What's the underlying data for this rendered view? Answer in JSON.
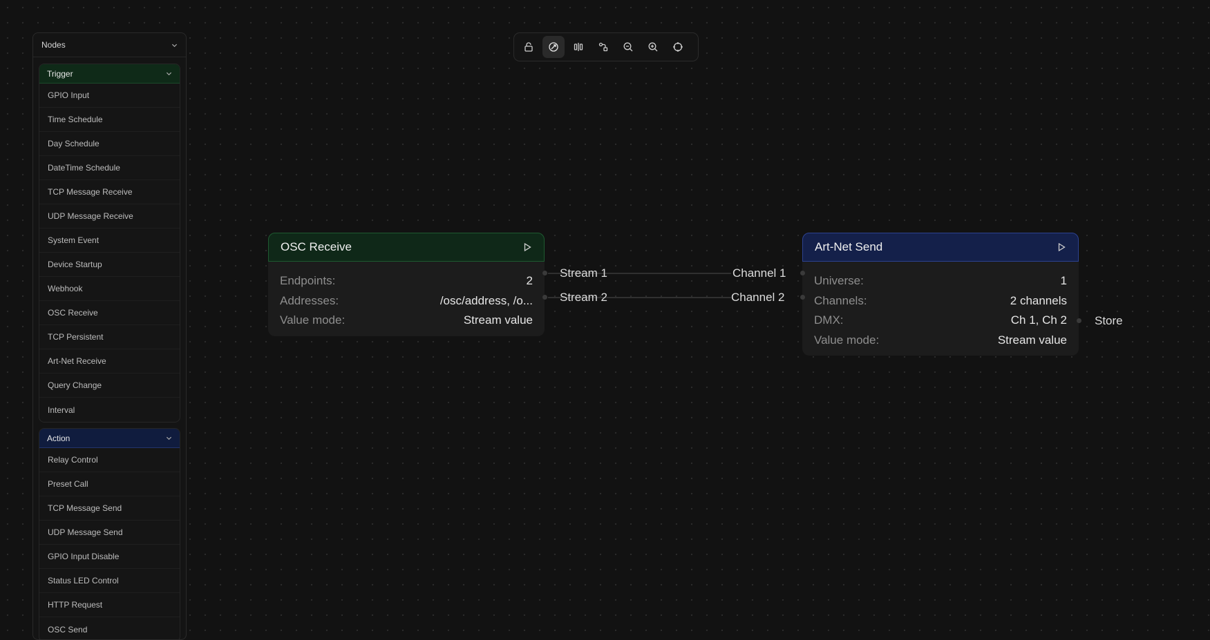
{
  "sidebar": {
    "title": "Nodes",
    "groups": [
      {
        "label": "Trigger",
        "items": [
          "GPIO Input",
          "Time Schedule",
          "Day Schedule",
          "DateTime Schedule",
          "TCP Message Receive",
          "UDP Message Receive",
          "System Event",
          "Device Startup",
          "Webhook",
          "OSC Receive",
          "TCP Persistent",
          "Art-Net Receive",
          "Query Change",
          "Interval"
        ]
      },
      {
        "label": "Action",
        "items": [
          "Relay Control",
          "Preset Call",
          "TCP Message Send",
          "UDP Message Send",
          "GPIO Input Disable",
          "Status LED Control",
          "HTTP Request",
          "OSC Send"
        ]
      }
    ]
  },
  "toolbar": {
    "buttons": [
      "lock-icon",
      "snap-icon",
      "align-icon",
      "auto-layout-icon",
      "zoom-out-icon",
      "zoom-in-icon",
      "fit-view-icon"
    ],
    "active": "snap-icon"
  },
  "nodes": {
    "osc": {
      "title": "OSC Receive",
      "rows": [
        {
          "label": "Endpoints:",
          "value": "2"
        },
        {
          "label": "Addresses:",
          "value": "/osc/address, /o..."
        },
        {
          "label": "Value mode:",
          "value": "Stream value"
        }
      ],
      "outputs": [
        "Stream 1",
        "Stream 2"
      ]
    },
    "artnet": {
      "title": "Art-Net Send",
      "rows": [
        {
          "label": "Universe:",
          "value": "1"
        },
        {
          "label": "Channels:",
          "value": "2 channels"
        },
        {
          "label": "DMX:",
          "value": "Ch 1, Ch 2"
        },
        {
          "label": "Value mode:",
          "value": "Stream value"
        }
      ],
      "inputs": [
        "Channel 1",
        "Channel 2"
      ],
      "outputs": [
        "Store"
      ]
    }
  },
  "colors": {
    "canvas": "#121212",
    "trigger": "#0f2818",
    "action": "#14204a"
  }
}
